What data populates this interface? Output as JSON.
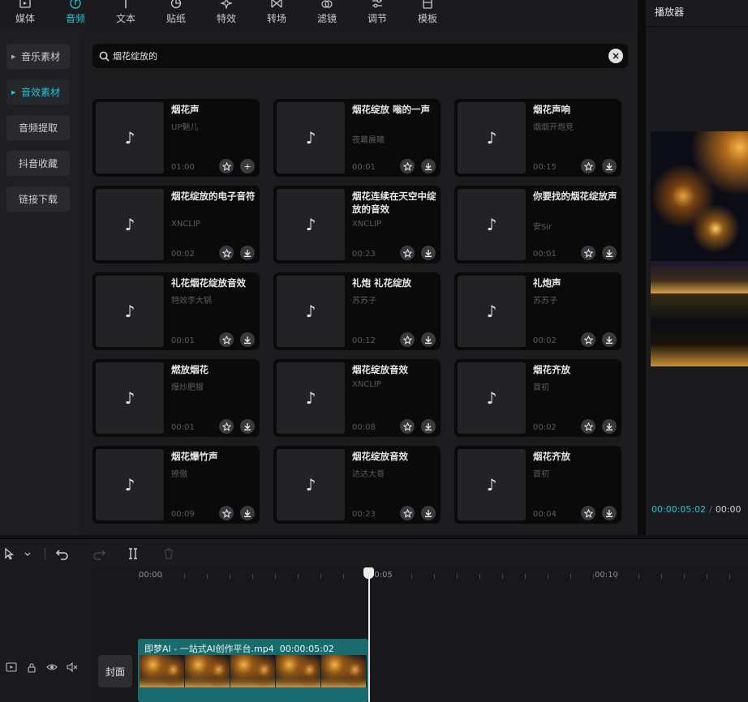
{
  "toolbar": {
    "items": [
      {
        "label": "媒体",
        "icon": "media-icon"
      },
      {
        "label": "音频",
        "icon": "audio-icon",
        "active": true
      },
      {
        "label": "文本",
        "icon": "text-icon"
      },
      {
        "label": "贴纸",
        "icon": "sticker-icon"
      },
      {
        "label": "特效",
        "icon": "effects-icon"
      },
      {
        "label": "转场",
        "icon": "transition-icon"
      },
      {
        "label": "滤镜",
        "icon": "filter-icon"
      },
      {
        "label": "调节",
        "icon": "adjust-icon"
      },
      {
        "label": "模板",
        "icon": "template-icon"
      }
    ]
  },
  "sidebar": {
    "items": [
      {
        "label": "音乐素材",
        "expandable": true
      },
      {
        "label": "音效素材",
        "expandable": true,
        "active": true
      },
      {
        "label": "音频提取"
      },
      {
        "label": "抖音收藏"
      },
      {
        "label": "链接下载"
      }
    ]
  },
  "search": {
    "value": "烟花绽放的"
  },
  "results": [
    {
      "title": "烟花声",
      "author": "UP魅儿",
      "duration": "01:00",
      "action": "add"
    },
    {
      "title": "烟花绽放 嗡的一声",
      "author": "夜幕晨曦",
      "duration": "00:01",
      "action": "download"
    },
    {
      "title": "烟花声响",
      "author": "烟烟开炮竞",
      "duration": "00:15",
      "action": "download"
    },
    {
      "title": "烟花绽放的电子音符",
      "author": "XNCLIP",
      "duration": "00:02",
      "action": "download"
    },
    {
      "title": "烟花连续在天空中绽放的音效",
      "author": "XNCLIP",
      "duration": "00:23",
      "action": "download"
    },
    {
      "title": "你要找的烟花绽放声",
      "author": "安Sir",
      "duration": "00:01",
      "action": "download"
    },
    {
      "title": "礼花烟花绽放音效",
      "author": "特效李大锅",
      "duration": "00:01",
      "action": "download"
    },
    {
      "title": "礼炮 礼花绽放",
      "author": "苏苏子",
      "duration": "00:12",
      "action": "download"
    },
    {
      "title": "礼炮声",
      "author": "苏苏子",
      "duration": "00:02",
      "action": "download"
    },
    {
      "title": "燃放烟花",
      "author": "爆炒肥猴",
      "duration": "00:01",
      "action": "download"
    },
    {
      "title": "烟花绽放音效",
      "author": "XNCLIP",
      "duration": "00:08",
      "action": "download"
    },
    {
      "title": "烟花齐放",
      "author": "首初",
      "duration": "00:02",
      "action": "download"
    },
    {
      "title": "烟花爆竹声",
      "author": "撩傲",
      "duration": "00:09",
      "action": "download"
    },
    {
      "title": "烟花绽放音效",
      "author": "达达大哥",
      "duration": "00:23",
      "action": "download"
    },
    {
      "title": "烟花齐放",
      "author": "首初",
      "duration": "00:04",
      "action": "download"
    }
  ],
  "player": {
    "title": "播放器",
    "current_time": "00:00:05:02",
    "total_time": "00:00"
  },
  "timeline": {
    "ruler": [
      "00:00",
      "00:05",
      "00:10"
    ],
    "cover_label": "封面",
    "clip_name": "即梦AI - 一站式AI创作平台.mp4",
    "clip_duration": "00:00:05:02"
  },
  "colors": {
    "accent": "#23c5d4",
    "clip": "#1a6b6e"
  }
}
